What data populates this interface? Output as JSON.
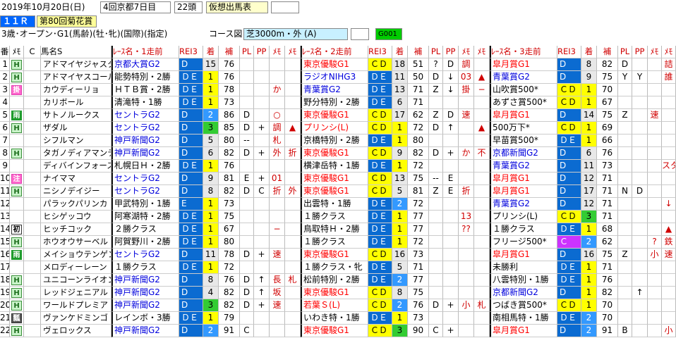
{
  "header": {
    "date": "2019年10月20日(日)",
    "meeting": "4回京都7日目",
    "runners": "22頭",
    "mode": "仮想出馬表"
  },
  "race": {
    "number": "１１Ｒ",
    "name": "第80回菊花賞",
    "conditions": "3歳･オープン･G1(馬齢)(牡･牝)(国際)(指定)",
    "course_label": "コース図",
    "course": "芝3000m・外 (A)",
    "code": "G001"
  },
  "columns": {
    "num": "番",
    "memo": "ﾒﾓ",
    "c": "C",
    "horse": "馬名S",
    "race1": "ﾚｰｽ名・1走前",
    "rei1": "REI3",
    "chaku1": "着",
    "ho1": "補",
    "pl1": "PL",
    "pp1": "PP",
    "memo1a": "ﾒﾓ",
    "memo1b": "ﾒﾓ",
    "race2": "ﾚｰｽ名・2走前",
    "rei2": "REI3",
    "chaku2": "着",
    "ho2": "補",
    "pl2": "PL",
    "pp2": "PP",
    "memo2a": "ﾒﾓ",
    "memo2b": "ﾒﾓ",
    "race3": "ﾚｰｽ名・3走前",
    "rei3": "REI3",
    "chaku3": "着",
    "ho3": "補",
    "pl3": "PL",
    "pp3": "PP",
    "memo3a": "ﾒﾓ",
    "memo3b": "ﾒﾓ"
  },
  "rows": [
    {
      "num": "1",
      "badge": "H",
      "bk": "",
      "horse": "アドマイヤジャスタ",
      "r1": "京都大賞G2",
      "r1c": "g2",
      "rk1": "D",
      "rk1c": "R",
      "c1": "15",
      "c1c": "cb",
      "h1": "76",
      "pl1": "",
      "pp1": "",
      "m1a": "",
      "m1b": "",
      "r2": "東京優駿G1",
      "r2c": "g1",
      "rk2": "ＣＤ",
      "rk2c": "y",
      "c2": "18",
      "c2c": "cb",
      "h2": "51",
      "pl2": "?",
      "pp2": "D",
      "m2a": "調",
      "m2b": "",
      "r3": "皐月賞G1",
      "r3c": "g1",
      "rk3": "D",
      "rk3c": "R",
      "c3": "8",
      "c3c": "cb",
      "h3": "82",
      "pl3": "D",
      "pp3": "",
      "m3a": "",
      "m3b": "詰"
    },
    {
      "num": "2",
      "badge": "H",
      "bk": "",
      "horse": "アドマイヤスコール",
      "r1": "能勢特別・2勝",
      "r1c": "",
      "rk1": "ＤＥ",
      "rk1c": "R",
      "c1": "1",
      "c1c": "p1",
      "h1": "76",
      "pl1": "",
      "pp1": "",
      "m1a": "",
      "m1b": "",
      "r2": "ラジオNIHG3",
      "r2c": "g2",
      "rk2": "ＤＥ",
      "rk2c": "R",
      "c2": "11",
      "c2c": "cb",
      "h2": "50",
      "pl2": "D",
      "pp2": "↓",
      "m2a": "03",
      "m2b": "▲",
      "r3": "青葉賞G2",
      "r3c": "g2",
      "rk3": "D",
      "rk3c": "R",
      "c3": "9",
      "c3c": "cb",
      "h3": "75",
      "pl3": "Y",
      "pp3": "Y",
      "m3a": "",
      "m3b": "誰"
    },
    {
      "num": "3",
      "badge": "掛",
      "bk": "r",
      "horse": "カウディーリョ",
      "r1": "ＨＴＢ賞・2勝",
      "r1c": "",
      "rk1": "ＤＥ",
      "rk1c": "R",
      "c1": "1",
      "c1c": "p1",
      "h1": "78",
      "pl1": "",
      "pp1": "",
      "m1a": "か",
      "m1b": "",
      "r2": "青葉賞G2",
      "r2c": "g2",
      "rk2": "ＤＥ",
      "rk2c": "R",
      "c2": "13",
      "c2c": "cb",
      "h2": "71",
      "pl2": "Z",
      "pp2": "↓",
      "m2a": "掛",
      "m2b": "−",
      "r3": "山吹賞500*",
      "r3c": "",
      "rk3": "ＣＤ",
      "rk3c": "y",
      "c3": "1",
      "c3c": "p1",
      "h3": "70",
      "pl3": "",
      "pp3": "",
      "m3a": "",
      "m3b": ""
    },
    {
      "num": "4",
      "badge": "",
      "bk": "",
      "horse": "カリボール",
      "r1": "清滝特・1勝",
      "r1c": "",
      "rk1": "ＤＥ",
      "rk1c": "R",
      "c1": "1",
      "c1c": "p1",
      "h1": "73",
      "pl1": "",
      "pp1": "",
      "m1a": "",
      "m1b": "",
      "r2": "野分特別・2勝",
      "r2c": "",
      "rk2": "ＤＥ",
      "rk2c": "R",
      "c2": "6",
      "c2c": "cb",
      "h2": "71",
      "pl2": "",
      "pp2": "",
      "m2a": "",
      "m2b": "",
      "r3": "あずさ賞500*",
      "r3c": "",
      "rk3": "ＣＤ",
      "rk3c": "y",
      "c3": "1",
      "c3c": "p1",
      "h3": "67",
      "pl3": "",
      "pp3": "",
      "m3a": "",
      "m3b": ""
    },
    {
      "num": "5",
      "badge": "雨",
      "bk": "b",
      "horse": "サトノルークス",
      "r1": "セントラG2",
      "r1c": "g2",
      "rk1": "D",
      "rk1c": "R",
      "c1": "2",
      "c1c": "p2",
      "h1": "86",
      "pl1": "D",
      "pp1": "",
      "m1a": "○",
      "m1b": "",
      "r2": "東京優駿G1",
      "r2c": "g1",
      "rk2": "ＣＤ",
      "rk2c": "y",
      "c2": "17",
      "c2c": "cb",
      "h2": "62",
      "pl2": "Z",
      "pp2": "D",
      "m2a": "速",
      "m2b": "",
      "r3": "皐月賞G1",
      "r3c": "g1",
      "rk3": "D",
      "rk3c": "R",
      "c3": "14",
      "c3c": "cb",
      "h3": "75",
      "pl3": "Z",
      "pp3": "",
      "m3a": "速",
      "m3b": ""
    },
    {
      "num": "6",
      "badge": "H",
      "bk": "",
      "horse": "ザダル",
      "r1": "セントラG2",
      "r1c": "g2",
      "rk1": "D",
      "rk1c": "R",
      "c1": "3",
      "c1c": "p3",
      "h1": "85",
      "pl1": "D",
      "pp1": "+",
      "m1a": "調",
      "m1b": "▲",
      "r2": "プリンシ(L)",
      "r2c": "g1",
      "rk2": "ＣＤ",
      "rk2c": "y",
      "c2": "1",
      "c2c": "p1",
      "h2": "72",
      "pl2": "D",
      "pp2": "↑",
      "m2a": "",
      "m2b": "▲",
      "r3": "500万下*",
      "r3c": "",
      "rk3": "ＣＤ",
      "rk3c": "y",
      "c3": "1",
      "c3c": "p1",
      "h3": "69",
      "pl3": "",
      "pp3": "",
      "m3a": "",
      "m3b": ""
    },
    {
      "num": "7",
      "badge": "",
      "bk": "",
      "horse": "シフルマン",
      "r1": "神戸新聞G2",
      "r1c": "g2",
      "rk1": "D",
      "rk1c": "R",
      "c1": "5",
      "c1c": "cb",
      "h1": "80",
      "pl1": "--",
      "pp1": "",
      "m1a": "札",
      "m1b": "",
      "r2": "京橋特別・2勝",
      "r2c": "",
      "rk2": "ＤＥ",
      "rk2c": "R",
      "c2": "1",
      "c2c": "p1",
      "h2": "80",
      "pl2": "",
      "pp2": "",
      "m2a": "",
      "m2b": "",
      "r3": "早苗賞500*",
      "r3c": "",
      "rk3": "ＤＥ",
      "rk3c": "R",
      "c3": "1",
      "c3c": "p1",
      "h3": "66",
      "pl3": "",
      "pp3": "",
      "m3a": "",
      "m3b": ""
    },
    {
      "num": "8",
      "badge": "H",
      "bk": "",
      "horse": "タガノディアマンテ",
      "r1": "神戸新聞G2",
      "r1c": "g2",
      "rk1": "D",
      "rk1c": "R",
      "c1": "6",
      "c1c": "cb",
      "h1": "82",
      "pl1": "D",
      "pp1": "+",
      "m1a": "外",
      "m1b": "折",
      "r2": "東京優駿G1",
      "r2c": "g1",
      "rk2": "ＣＤ",
      "rk2c": "y",
      "c2": "9",
      "c2c": "cb",
      "h2": "82",
      "pl2": "D",
      "pp2": "+",
      "m2a": "か",
      "m2b": "不",
      "r3": "京都新聞G2",
      "r3c": "g2",
      "rk3": "D",
      "rk3c": "R",
      "c3": "6",
      "c3c": "cb",
      "h3": "76",
      "pl3": "",
      "pp3": "",
      "m3a": "",
      "m3b": ""
    },
    {
      "num": "9",
      "badge": "",
      "bk": "",
      "horse": "ディバインフォース",
      "r1": "札幌日Ｈ・2勝",
      "r1c": "",
      "rk1": "ＤＥ",
      "rk1c": "R",
      "c1": "1",
      "c1c": "p1",
      "h1": "76",
      "pl1": "",
      "pp1": "",
      "m1a": "",
      "m1b": "",
      "r2": "横津岳特・1勝",
      "r2c": "",
      "rk2": "ＤＥ",
      "rk2c": "R",
      "c2": "1",
      "c2c": "p1",
      "h2": "72",
      "pl2": "",
      "pp2": "",
      "m2a": "",
      "m2b": "",
      "r3": "青葉賞G2",
      "r3c": "g2",
      "rk3": "D",
      "rk3c": "R",
      "c3": "11",
      "c3c": "cb",
      "h3": "73",
      "pl3": "",
      "pp3": "",
      "m3a": "",
      "m3b": "スタ"
    },
    {
      "num": "10",
      "badge": "注",
      "bk": "r",
      "horse": "ナイママ",
      "r1": "セントラG2",
      "r1c": "g2",
      "rk1": "D",
      "rk1c": "R",
      "c1": "9",
      "c1c": "cb",
      "h1": "81",
      "pl1": "E",
      "pp1": "+",
      "m1a": "01",
      "m1b": "",
      "r2": "東京優駿G1",
      "r2c": "g1",
      "rk2": "ＣＤ",
      "rk2c": "y",
      "c2": "13",
      "c2c": "cb",
      "h2": "75",
      "pl2": "--",
      "pp2": "E",
      "m2a": "",
      "m2b": "",
      "r3": "皐月賞G1",
      "r3c": "g1",
      "rk3": "D",
      "rk3c": "R",
      "c3": "12",
      "c3c": "cb",
      "h3": "71",
      "pl3": "",
      "pp3": "",
      "m3a": "",
      "m3b": ""
    },
    {
      "num": "11",
      "badge": "H",
      "bk": "",
      "horse": "ニシノデイジー",
      "r1": "セントラG2",
      "r1c": "g2",
      "rk1": "D",
      "rk1c": "R",
      "c1": "8",
      "c1c": "cb",
      "h1": "82",
      "pl1": "D",
      "pp1": "C",
      "m1a": "折",
      "m1b": "外",
      "r2": "東京優駿G1",
      "r2c": "g1",
      "rk2": "ＣＤ",
      "rk2c": "y",
      "c2": "5",
      "c2c": "cb",
      "h2": "81",
      "pl2": "Z",
      "pp2": "E",
      "m2a": "折",
      "m2b": "",
      "r3": "皐月賞G1",
      "r3c": "g1",
      "rk3": "D",
      "rk3c": "R",
      "c3": "17",
      "c3c": "cb",
      "h3": "71",
      "pl3": "N",
      "pp3": "D",
      "m3a": "",
      "m3b": ""
    },
    {
      "num": "12",
      "badge": "",
      "bk": "",
      "horse": "パラックパリンカ",
      "r1": "甲武特別・1勝",
      "r1c": "",
      "rk1": "E",
      "rk1c": "R",
      "c1": "1",
      "c1c": "p1",
      "h1": "73",
      "pl1": "",
      "pp1": "",
      "m1a": "",
      "m1b": "",
      "r2": "出雲特・1勝",
      "r2c": "",
      "rk2": "ＤＥ",
      "rk2c": "R",
      "c2": "2",
      "c2c": "p2",
      "h2": "72",
      "pl2": "",
      "pp2": "",
      "m2a": "",
      "m2b": "",
      "r3": "青葉賞G2",
      "r3c": "g2",
      "rk3": "D",
      "rk3c": "R",
      "c3": "12",
      "c3c": "cb",
      "h3": "71",
      "pl3": "",
      "pp3": "",
      "m3a": "",
      "m3b": "↓"
    },
    {
      "num": "13",
      "badge": "",
      "bk": "",
      "horse": "ヒシゲッコウ",
      "r1": "阿寒湖特・2勝",
      "r1c": "",
      "rk1": "ＤＥ",
      "rk1c": "R",
      "c1": "1",
      "c1c": "p1",
      "h1": "75",
      "pl1": "",
      "pp1": "",
      "m1a": "",
      "m1b": "",
      "r2": "１勝クラス",
      "r2c": "",
      "rk2": "ＤＥ",
      "rk2c": "R",
      "c2": "1",
      "c2c": "p1",
      "h2": "77",
      "pl2": "",
      "pp2": "",
      "m2a": "13",
      "m2b": "",
      "r3": "プリンシ(L)",
      "r3c": "",
      "rk3": "ＣＤ",
      "rk3c": "y",
      "c3": "3",
      "c3c": "p3",
      "h3": "71",
      "pl3": "",
      "pp3": "",
      "m3a": "",
      "m3b": ""
    },
    {
      "num": "14",
      "badge": "初",
      "bk": "w",
      "horse": "ヒッチコック",
      "r1": "２勝クラス",
      "r1c": "",
      "rk1": "ＤＥ",
      "rk1c": "R",
      "c1": "1",
      "c1c": "p1",
      "h1": "67",
      "pl1": "",
      "pp1": "",
      "m1a": "−",
      "m1b": "",
      "r2": "鳥取特Ｈ・2勝",
      "r2c": "",
      "rk2": "ＤＥ",
      "rk2c": "R",
      "c2": "1",
      "c2c": "p1",
      "h2": "77",
      "pl2": "",
      "pp2": "",
      "m2a": "??",
      "m2b": "",
      "r3": "１勝クラス",
      "r3c": "",
      "rk3": "ＤＥ",
      "rk3c": "R",
      "c3": "1",
      "c3c": "p1",
      "h3": "68",
      "pl3": "",
      "pp3": "",
      "m3a": "",
      "m3b": "▲"
    },
    {
      "num": "15",
      "badge": "H",
      "bk": "",
      "horse": "ホウオウサーベル",
      "r1": "阿賀野川・2勝",
      "r1c": "",
      "rk1": "ＤＥ",
      "rk1c": "R",
      "c1": "1",
      "c1c": "p1",
      "h1": "80",
      "pl1": "",
      "pp1": "",
      "m1a": "",
      "m1b": "",
      "r2": "１勝クラス",
      "r2c": "",
      "rk2": "ＤＥ",
      "rk2c": "R",
      "c2": "1",
      "c2c": "p1",
      "h2": "72",
      "pl2": "",
      "pp2": "",
      "m2a": "",
      "m2b": "",
      "r3": "フリージ500*",
      "r3c": "",
      "rk3": "Ｃ",
      "rk3c": "m",
      "c3": "2",
      "c3c": "p2",
      "h3": "62",
      "pl3": "",
      "pp3": "",
      "m3a": "?",
      "m3b": "鉄"
    },
    {
      "num": "16",
      "badge": "雨",
      "bk": "b",
      "horse": "メイショウテンゲン",
      "r1": "セントラG2",
      "r1c": "g2",
      "rk1": "D",
      "rk1c": "R",
      "c1": "11",
      "c1c": "cb",
      "h1": "78",
      "pl1": "D",
      "pp1": "+",
      "m1a": "速",
      "m1b": "",
      "r2": "東京優駿G1",
      "r2c": "g1",
      "rk2": "ＣＤ",
      "rk2c": "y",
      "c2": "16",
      "c2c": "cb",
      "h2": "73",
      "pl2": "",
      "pp2": "",
      "m2a": "",
      "m2b": "",
      "r3": "皐月賞G1",
      "r3c": "g1",
      "rk3": "D",
      "rk3c": "R",
      "c3": "16",
      "c3c": "cb",
      "h3": "75",
      "pl3": "Z",
      "pp3": "",
      "m3a": "小",
      "m3b": "速"
    },
    {
      "num": "17",
      "badge": "",
      "bk": "",
      "horse": "メロディーレーン",
      "r1": "１勝クラス",
      "r1c": "",
      "rk1": "ＤＥ",
      "rk1c": "R",
      "c1": "1",
      "c1c": "p1",
      "h1": "72",
      "pl1": "",
      "pp1": "",
      "m1a": "",
      "m1b": "",
      "r2": "１勝クラス・牝",
      "r2c": "",
      "rk2": "ＤＥ",
      "rk2c": "R",
      "c2": "5",
      "c2c": "cb",
      "h2": "71",
      "pl2": "",
      "pp2": "",
      "m2a": "",
      "m2b": "",
      "r3": "未勝利",
      "r3c": "",
      "rk3": "ＤＥ",
      "rk3c": "R",
      "c3": "1",
      "c3c": "p1",
      "h3": "71",
      "pl3": "",
      "pp3": "",
      "m3a": "",
      "m3b": ""
    },
    {
      "num": "18",
      "badge": "H",
      "bk": "",
      "horse": "ユニコーンライオン",
      "r1": "神戸新聞G2",
      "r1c": "g2",
      "rk1": "D",
      "rk1c": "R",
      "c1": "8",
      "c1c": "cb",
      "h1": "76",
      "pl1": "D",
      "pp1": "↑",
      "m1a": "長",
      "m1b": "札",
      "r2": "松前特別・2勝",
      "r2c": "",
      "rk2": "ＤＥ",
      "rk2c": "R",
      "c2": "2",
      "c2c": "p2",
      "h2": "77",
      "pl2": "",
      "pp2": "",
      "m2a": "",
      "m2b": "",
      "r3": "八雲特別・1勝",
      "r3c": "",
      "rk3": "ＤＥ",
      "rk3c": "R",
      "c3": "1",
      "c3c": "p1",
      "h3": "76",
      "pl3": "",
      "pp3": "",
      "m3a": "",
      "m3b": ""
    },
    {
      "num": "19",
      "badge": "H",
      "bk": "",
      "horse": "レッドジェニアル",
      "r1": "神戸新聞G2",
      "r1c": "g2",
      "rk1": "D",
      "rk1c": "R",
      "c1": "4",
      "c1c": "cb",
      "h1": "82",
      "pl1": "D",
      "pp1": "↑",
      "m1a": "坂",
      "m1b": "",
      "r2": "東京優駿G1",
      "r2c": "g1",
      "rk2": "ＣＤ",
      "rk2c": "y",
      "c2": "8",
      "c2c": "cb",
      "h2": "75",
      "pl2": "",
      "pp2": "",
      "m2a": "",
      "m2b": "",
      "r3": "京都新聞G2",
      "r3c": "g2",
      "rk3": "D",
      "rk3c": "R",
      "c3": "1",
      "c3c": "p1",
      "h3": "82",
      "pl3": "",
      "pp3": "↑",
      "m3a": "",
      "m3b": ""
    },
    {
      "num": "20",
      "badge": "H",
      "bk": "",
      "horse": "ワールドプレミア",
      "r1": "神戸新聞G2",
      "r1c": "g2",
      "rk1": "D",
      "rk1c": "R",
      "c1": "3",
      "c1c": "p3",
      "h1": "82",
      "pl1": "D",
      "pp1": "+",
      "m1a": "速",
      "m1b": "",
      "r2": "若葉Ｓ(L)",
      "r2c": "g1",
      "rk2": "ＣＤ",
      "rk2c": "y",
      "c2": "2",
      "c2c": "p2",
      "h2": "76",
      "pl2": "D",
      "pp2": "+",
      "m2a": "小",
      "m2b": "札",
      "r3": "つばき賞500*",
      "r3c": "",
      "rk3": "ＣＤ",
      "rk3c": "y",
      "c3": "1",
      "c3c": "p1",
      "h3": "70",
      "pl3": "",
      "pp3": "",
      "m3a": "",
      "m3b": ""
    },
    {
      "num": "21",
      "badge": "瓢",
      "bk": "k",
      "horse": "ヴァンケドミンゴ",
      "r1": "レインボ・3勝",
      "r1c": "",
      "rk1": "ＤＥ",
      "rk1c": "R",
      "c1": "1",
      "c1c": "p1",
      "h1": "79",
      "pl1": "",
      "pp1": "",
      "m1a": "",
      "m1b": "",
      "r2": "いわき特・1勝",
      "r2c": "",
      "rk2": "ＤＥ",
      "rk2c": "R",
      "c2": "1",
      "c2c": "p1",
      "h2": "73",
      "pl2": "",
      "pp2": "",
      "m2a": "",
      "m2b": "",
      "r3": "南相馬特・1勝",
      "r3c": "",
      "rk3": "ＤＥ",
      "rk3c": "R",
      "c3": "2",
      "c3c": "p2",
      "h3": "70",
      "pl3": "",
      "pp3": "",
      "m3a": "",
      "m3b": ""
    },
    {
      "num": "22",
      "badge": "H",
      "bk": "",
      "horse": "ヴェロックス",
      "r1": "神戸新聞G2",
      "r1c": "g2",
      "rk1": "D",
      "rk1c": "R",
      "c1": "2",
      "c1c": "p2",
      "h1": "91",
      "pl1": "C",
      "pp1": "",
      "m1a": "",
      "m1b": "",
      "r2": "東京優駿G1",
      "r2c": "g1",
      "rk2": "ＣＤ",
      "rk2c": "y",
      "c2": "3",
      "c2c": "p3",
      "h2": "90",
      "pl2": "C",
      "pp2": "+",
      "m2a": "",
      "m2b": "",
      "r3": "皐月賞G1",
      "r3c": "g1",
      "rk3": "D",
      "rk3c": "R",
      "c3": "2",
      "c3c": "p2",
      "h3": "91",
      "pl3": "B",
      "pp3": "",
      "m3a": "",
      "m3b": "小"
    }
  ]
}
